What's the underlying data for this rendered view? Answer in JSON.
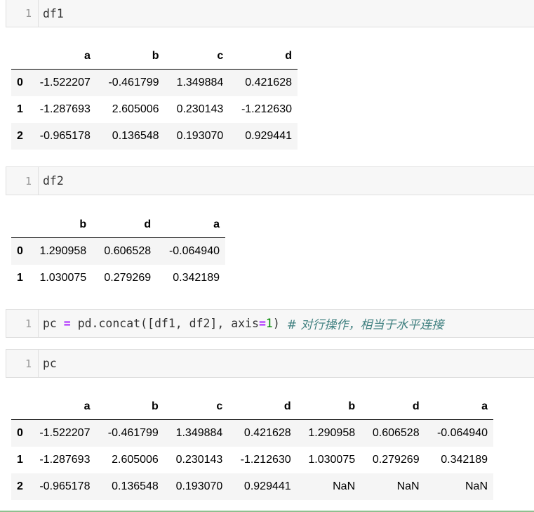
{
  "cells": {
    "c1": {
      "line": "1",
      "code": "df1"
    },
    "c2": {
      "line": "1",
      "code": "df2"
    },
    "c3": {
      "line": "1",
      "var": "pc",
      "eq": " = ",
      "call": "pd.concat([df1, df2], axis",
      "assign": "=",
      "num": "1",
      "close": ") ",
      "comment": "# 对行操作，相当于水平连接"
    },
    "c4": {
      "line": "1",
      "code": "pc"
    }
  },
  "df1": {
    "columns": [
      "a",
      "b",
      "c",
      "d"
    ],
    "index": [
      "0",
      "1",
      "2"
    ],
    "rows": [
      [
        "-1.522207",
        "-0.461799",
        "1.349884",
        "0.421628"
      ],
      [
        "-1.287693",
        "2.605006",
        "0.230143",
        "-1.212630"
      ],
      [
        "-0.965178",
        "0.136548",
        "0.193070",
        "0.929441"
      ]
    ]
  },
  "df2": {
    "columns": [
      "b",
      "d",
      "a"
    ],
    "index": [
      "0",
      "1"
    ],
    "rows": [
      [
        "1.290958",
        "0.606528",
        "-0.064940"
      ],
      [
        "1.030075",
        "0.279269",
        "0.342189"
      ]
    ]
  },
  "pc": {
    "columns": [
      "a",
      "b",
      "c",
      "d",
      "b",
      "d",
      "a"
    ],
    "index": [
      "0",
      "1",
      "2"
    ],
    "rows": [
      [
        "-1.522207",
        "-0.461799",
        "1.349884",
        "0.421628",
        "1.290958",
        "0.606528",
        "-0.064940"
      ],
      [
        "-1.287693",
        "2.605006",
        "0.230143",
        "-1.212630",
        "1.030075",
        "0.279269",
        "0.342189"
      ],
      [
        "-0.965178",
        "0.136548",
        "0.193070",
        "0.929441",
        "NaN",
        "NaN",
        "NaN"
      ]
    ]
  }
}
